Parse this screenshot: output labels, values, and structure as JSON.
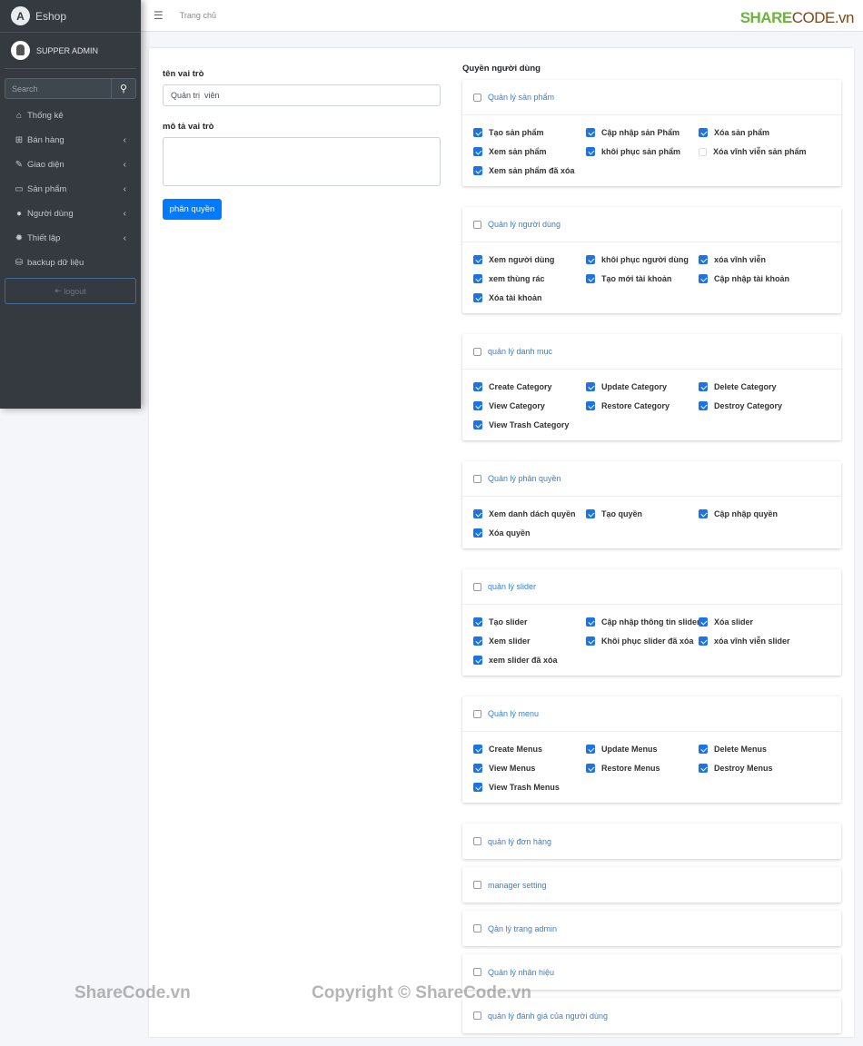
{
  "sidebar": {
    "brand": "Eshop",
    "user": "SUPPER ADMIN",
    "search_placeholder": "Search",
    "items": [
      {
        "label": "Thống kê",
        "icon": "home-icon",
        "chev": false
      },
      {
        "label": "Bán hàng",
        "icon": "shopping-bag-icon",
        "chev": true
      },
      {
        "label": "Giao diện",
        "icon": "brush-icon",
        "chev": true
      },
      {
        "label": "Sản phẩm",
        "icon": "box-icon",
        "chev": true
      },
      {
        "label": "Người dùng",
        "icon": "user-icon",
        "chev": true
      },
      {
        "label": "Thiết lập",
        "icon": "gear-icon",
        "chev": true
      },
      {
        "label": "backup dữ liệu",
        "icon": "database-icon",
        "chev": false
      }
    ],
    "logout": "logout"
  },
  "header": {
    "breadcrumb": "Trang chủ",
    "logo_text": "SHARECODE.vn"
  },
  "form": {
    "name_label": "tên vai trò",
    "name_value": "Quản trị  viên",
    "desc_label": "mô tả vai trò",
    "desc_value": "",
    "submit": "phân quyền"
  },
  "permissions": {
    "title": "Quyền người dùng",
    "accent": "#1a73e8",
    "groups": [
      {
        "name": "Quản lý sản phẩm",
        "checked": false,
        "items": [
          {
            "l": "Tạo sản phẩm",
            "c": true
          },
          {
            "l": "Cập nhập sản Phẩm",
            "c": true
          },
          {
            "l": "Xóa sản phẩm",
            "c": true
          },
          {
            "l": "Xem sản phẩm",
            "c": true
          },
          {
            "l": "khôi phục sản phẩm",
            "c": true
          },
          {
            "l": "Xóa vĩnh viễn sản phẩm",
            "c": false
          },
          {
            "l": "Xem sản phẩm đã xóa",
            "c": true
          }
        ]
      },
      {
        "name": "Quản lý người dùng",
        "checked": false,
        "items": [
          {
            "l": "Xem người dùng",
            "c": true
          },
          {
            "l": "khôi phục người dùng",
            "c": true
          },
          {
            "l": "xóa vĩnh viễn",
            "c": true
          },
          {
            "l": "xem thùng rác",
            "c": true
          },
          {
            "l": "Tạo mới tài khoản",
            "c": true
          },
          {
            "l": "Cập nhập tài khoản",
            "c": true
          },
          {
            "l": "Xóa tài khoản",
            "c": true
          }
        ]
      },
      {
        "name": "quản lý danh mục",
        "checked": false,
        "items": [
          {
            "l": "Create Category",
            "c": true
          },
          {
            "l": "Update Category",
            "c": true
          },
          {
            "l": "Delete Category",
            "c": true
          },
          {
            "l": "View Category",
            "c": true
          },
          {
            "l": "Restore Category",
            "c": true
          },
          {
            "l": "Destroy Category",
            "c": true
          },
          {
            "l": "View Trash Category",
            "c": true
          }
        ]
      },
      {
        "name": "Quản lý phân quyền",
        "checked": false,
        "items": [
          {
            "l": "Xem danh dách quyền",
            "c": true
          },
          {
            "l": "Tạo quyền",
            "c": true
          },
          {
            "l": "Cập nhập quyền",
            "c": true
          },
          {
            "l": "Xóa quyền",
            "c": true
          }
        ]
      },
      {
        "name": "quản lý slider",
        "checked": false,
        "items": [
          {
            "l": "Tạo slider",
            "c": true
          },
          {
            "l": "Cập nhập thông tin slider",
            "c": true
          },
          {
            "l": "Xóa slider",
            "c": true
          },
          {
            "l": "Xem slider",
            "c": true
          },
          {
            "l": "Khôi phục slider đã xóa",
            "c": true
          },
          {
            "l": "xóa vĩnh viễn slider",
            "c": true
          },
          {
            "l": "xem slider đã xóa",
            "c": true
          }
        ]
      },
      {
        "name": "Quản lý menu",
        "checked": false,
        "items": [
          {
            "l": "Create Menus",
            "c": true
          },
          {
            "l": "Update Menus",
            "c": true
          },
          {
            "l": "Delete Menus",
            "c": true
          },
          {
            "l": "View Menus",
            "c": true
          },
          {
            "l": "Restore Menus",
            "c": true
          },
          {
            "l": "Destroy Menus",
            "c": true
          },
          {
            "l": "View Trash Menus",
            "c": true
          }
        ]
      },
      {
        "name": "quản lý đơn hàng",
        "checked": false,
        "items": []
      },
      {
        "name": "manager setting",
        "checked": false,
        "items": []
      },
      {
        "name": "Qản lý trang admin",
        "checked": false,
        "items": []
      },
      {
        "name": "Quản lý nhãn hiệu",
        "checked": false,
        "items": []
      },
      {
        "name": "quản lý đánh giá của người dùng",
        "checked": false,
        "items": []
      }
    ]
  },
  "watermark": {
    "left": "ShareCode.vn",
    "center": "Copyright © ShareCode.vn"
  }
}
